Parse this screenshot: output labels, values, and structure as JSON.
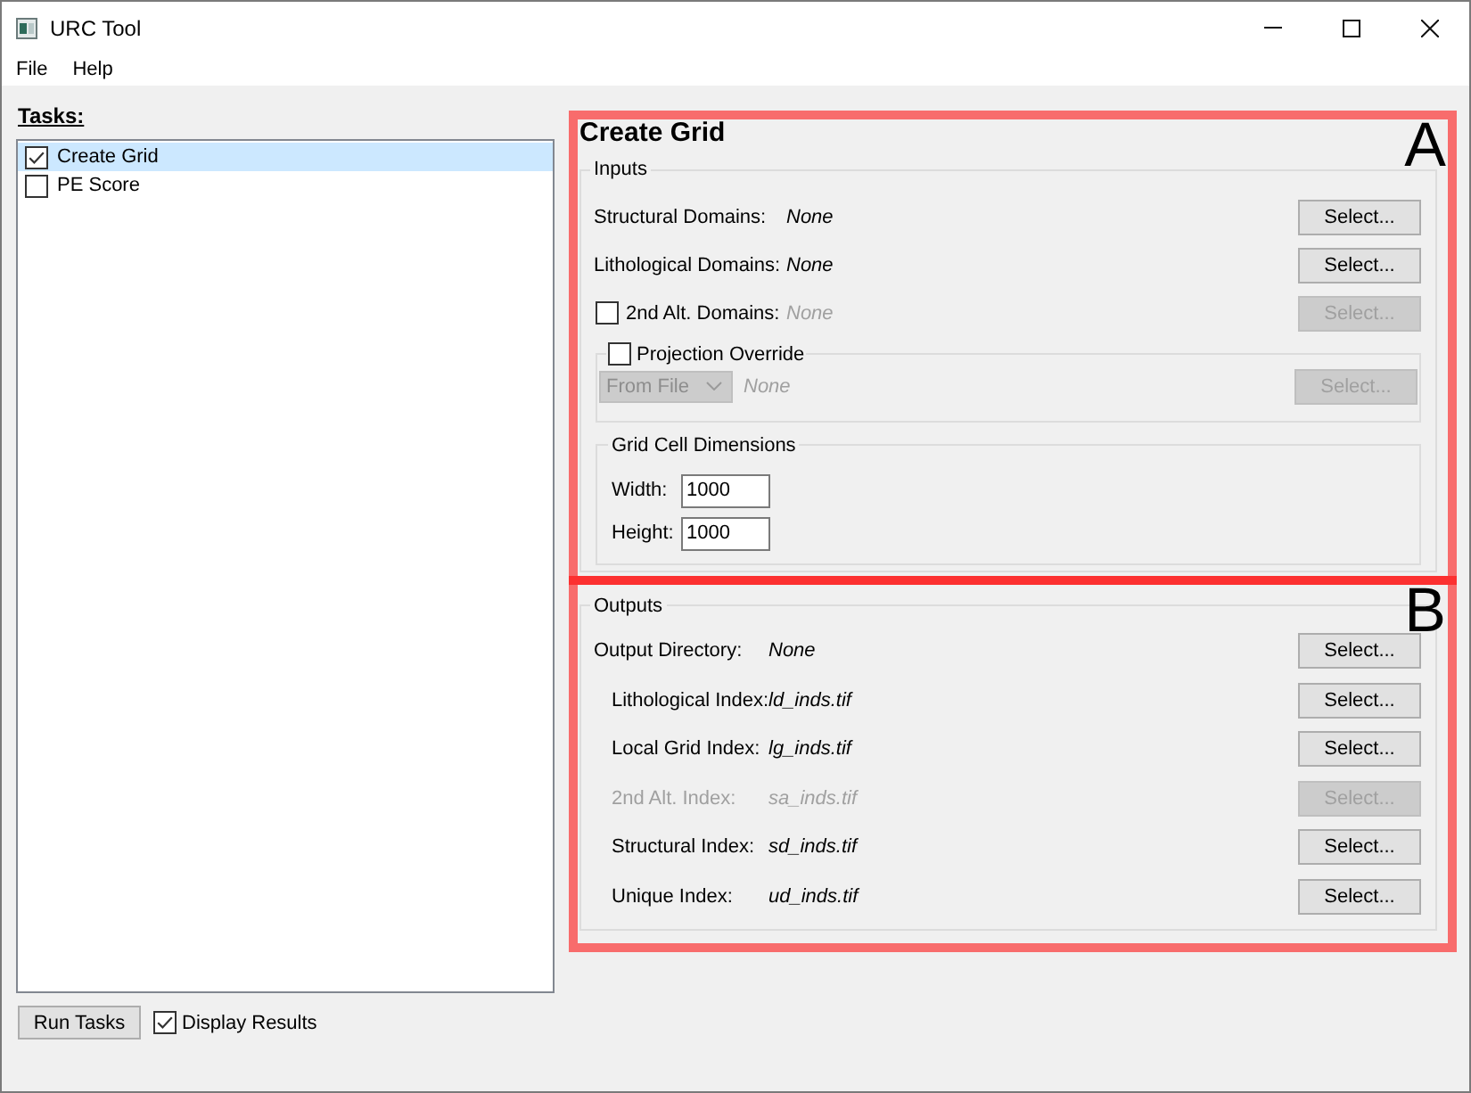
{
  "window": {
    "title": "URC Tool"
  },
  "menu": [
    "File",
    "Help"
  ],
  "tasks": {
    "heading": "Tasks:",
    "items": [
      {
        "label": "Create Grid",
        "checked": true,
        "selected": true
      },
      {
        "label": "PE Score",
        "checked": false,
        "selected": false
      }
    ]
  },
  "footer": {
    "run_button": "Run Tasks",
    "display_results": {
      "label": "Display Results",
      "checked": true
    }
  },
  "panel": {
    "title": "Create Grid",
    "inputs": {
      "title": "Inputs",
      "rows": [
        {
          "kind": "plain",
          "label": "Structural Domains:",
          "value": "None",
          "button": "Select...",
          "disabled": false
        },
        {
          "kind": "plain",
          "label": "Lithological Domains:",
          "value": "None",
          "button": "Select...",
          "disabled": false
        },
        {
          "kind": "checkbox",
          "label": "2nd Alt. Domains:",
          "checked": false,
          "value": "None",
          "button": "Select...",
          "disabled": true
        }
      ],
      "projection_override": {
        "label": "Projection Override",
        "checked": false,
        "dropdown": "From File",
        "value": "None",
        "button": "Select...",
        "disabled": true
      },
      "grid_cell_dimensions": {
        "title": "Grid Cell Dimensions",
        "fields": [
          {
            "label": "Width:",
            "value": "1000"
          },
          {
            "label": "Height:",
            "value": "1000"
          }
        ]
      }
    },
    "outputs": {
      "title": "Outputs",
      "rows": [
        {
          "label": "Output Directory:",
          "value": "None",
          "button": "Select...",
          "disabled": false,
          "children": [
            {
              "label": "Lithological Index:",
              "value": "ld_inds.tif",
              "button": "Select...",
              "disabled": false
            },
            {
              "label": "Local Grid Index:",
              "value": "lg_inds.tif",
              "button": "Select...",
              "disabled": false
            },
            {
              "label": "2nd Alt. Index:",
              "value": "sa_inds.tif",
              "button": "Select...",
              "disabled": true
            },
            {
              "label": "Structural Index:",
              "value": "sd_inds.tif",
              "button": "Select...",
              "disabled": false
            },
            {
              "label": "Unique Index:",
              "value": "ud_inds.tif",
              "button": "Select...",
              "disabled": false
            }
          ]
        }
      ]
    }
  },
  "annotations": [
    {
      "label": "A"
    },
    {
      "label": "B"
    }
  ]
}
